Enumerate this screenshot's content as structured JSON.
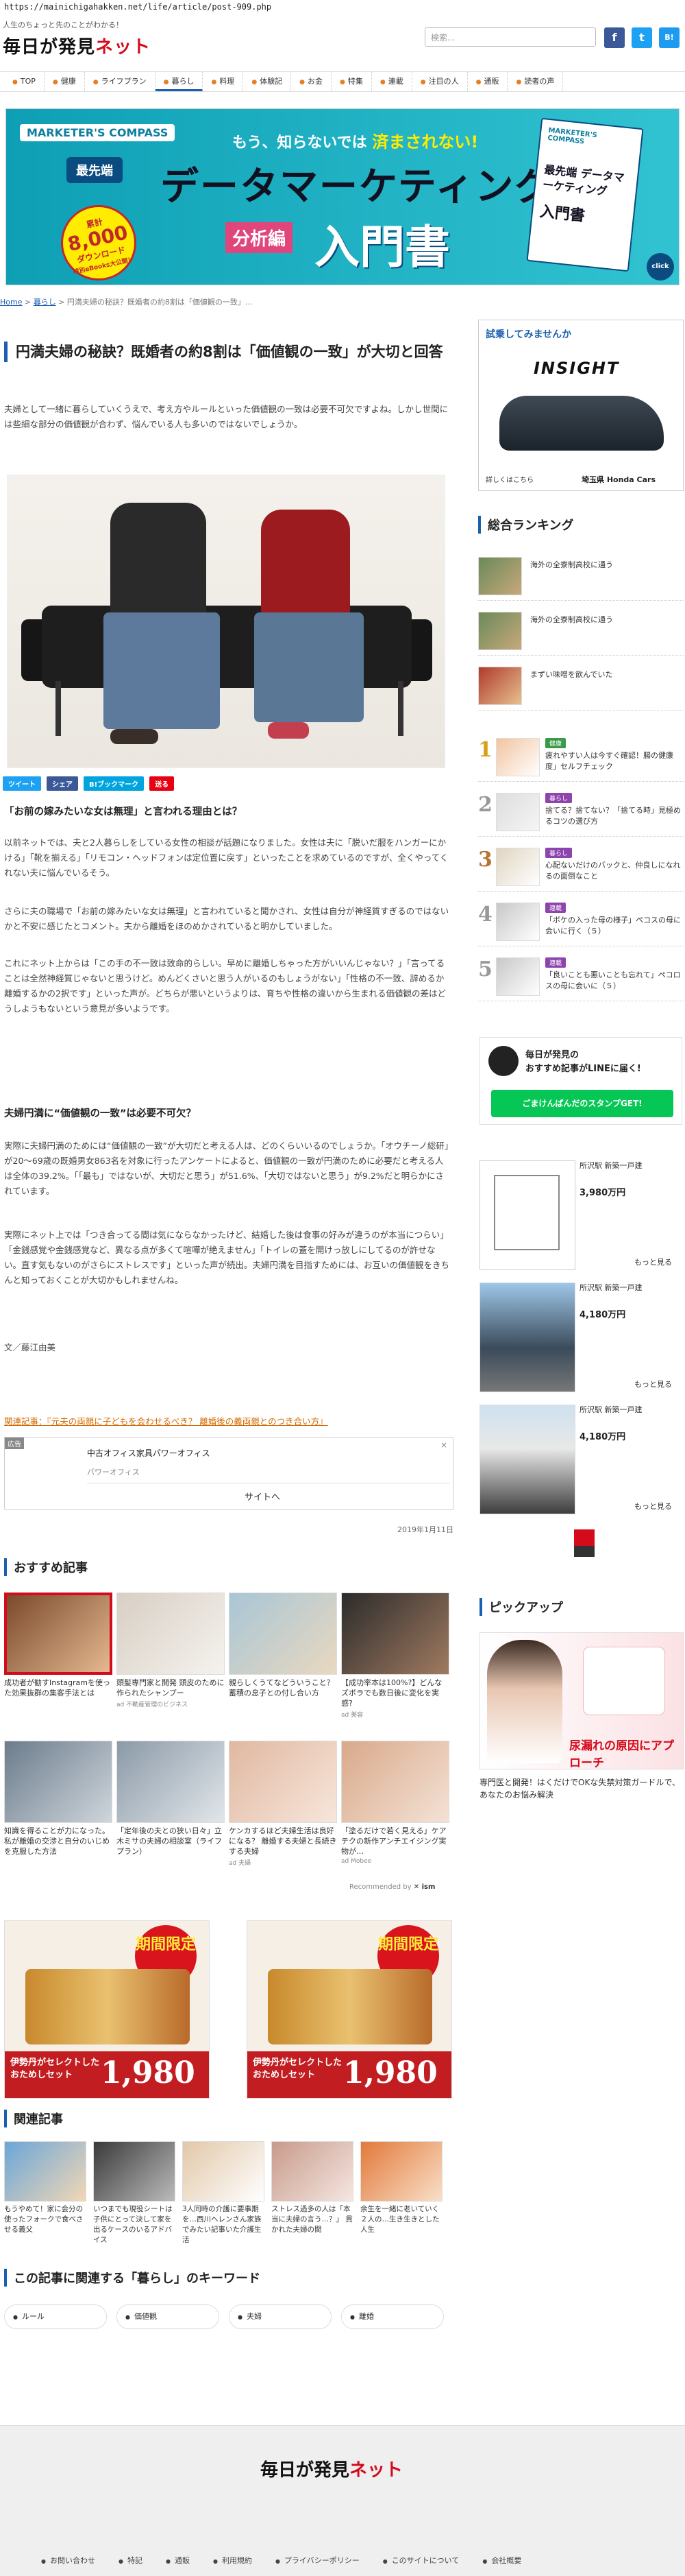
{
  "url": "https://mainichigahakken.net/life/article/post-909.php",
  "header": {
    "tagline": "人生のちょっと先のことがわかる！",
    "logo_main": "毎日が発見",
    "logo_net": "ネット",
    "search_placeholder": "検索...",
    "social": [
      "f",
      "t",
      "B!"
    ]
  },
  "nav": {
    "items": [
      {
        "label": "TOP"
      },
      {
        "label": "健康"
      },
      {
        "label": "ライフプラン"
      },
      {
        "label": "暮らし"
      },
      {
        "label": "料理"
      },
      {
        "label": "体験記"
      },
      {
        "label": "お金"
      },
      {
        "label": "特集"
      },
      {
        "label": "連載"
      },
      {
        "label": "注目の人"
      },
      {
        "label": "通販"
      },
      {
        "label": "読者の声"
      }
    ]
  },
  "banner": {
    "brand": "MARKETER'S COMPASS",
    "tag": "最先端",
    "top": "もう、知らないでは",
    "top_em": "済まされない!",
    "title": "データマーケティング",
    "sub1": "分析編",
    "sub2": "入門書",
    "badge_line1": "累計",
    "badge_big": "8,000",
    "badge_line2": "ダウンロード",
    "badge_line3": "特別eBooks大公開！",
    "book_brand": "MARKETER'S COMPASS",
    "book_title": "最先端 データマーケティング",
    "book_sub": "入門書",
    "click": "click"
  },
  "breadcrumb": {
    "home": "Home",
    "cat": "暮らし",
    "current": "円満夫婦の秘訣？既婚者の約8割は「価値観の一致」..."
  },
  "article": {
    "title": "円満夫婦の秘訣？既婚者の約8割は「価値観の一致」が大切と回答",
    "intro": "夫婦として一緒に暮らしていくうえで、考え方やルールといった価値観の一致は必要不可欠ですよね。しかし世間には些細な部分の価値観が合わず、悩んでいる人も多いのではないでしょうか。",
    "share": [
      "ツイート",
      "シェア",
      "B!ブックマーク",
      "送る"
    ],
    "h_1": "「お前の嫁みたいな女は無理」と言われる理由とは？",
    "p_1": "以前ネットでは、夫と2人暮らしをしている女性の相談が話題になりました。女性は夫に「脱いだ服をハンガーにかける」「靴を揃える」「リモコン・ヘッドフォンは定位置に戻す」といったことを求めているのですが、全くやってくれない夫に悩んでいるそう。",
    "p_2": "さらに夫の職場で「お前の嫁みたいな女は無理」と言われていると聞かされ、女性は自分が神経質すぎるのではないかと不安に感じたとコメント。夫から離婚をほのめかされていると明かしていました。",
    "p_3": "これにネット上からは「この手の不一致は致命的らしい。早めに離婚しちゃった方がいいんじゃない？」「言ってることは全然神経質じゃないと思うけど。めんどくさいと思う人がいるのもしょうがない」「性格の不一致、辞めるか離婚するかの2択です」といった声が。どちらが悪いというよりは、育ちや性格の違いから生まれる価値観の差はどうしようもないという意見が多いようです。",
    "h_2": "夫婦円満に“価値観の一致”は必要不可欠？",
    "p_4": "実際に夫婦円満のためには“価値観の一致”が大切だと考える人は、どのくらいいるのでしょうか。「オウチーノ総研」が20〜69歳の既婚男女863名を対象に行ったアンケートによると、価値観の一致が円満のために必要だと考える人は全体の39.2%。「「最も」ではないが、大切だと思う」が51.6%、「大切ではないと思う」が9.2%だと明らかにされています。",
    "p_5": "実際にネット上では「つき合ってる間は気にならなかったけど、結婚した後は食事の好みが違うのが本当につらい」「金銭感覚や金銭感覚など、異なる点が多くて喧嘩が絶えません」「トイレの蓋を開けっ放しにしてるのが許せない。直す気もないのがさらにストレスです」といった声が続出。夫婦円満を目指すためには、お互いの価値観をきちんと知っておくことが大切かもしれませんね。",
    "author": "文／藤江由美",
    "related_link": "関連記事：『元夫の両親に子どもを会わせるべき？ 離婚後の義両親とのつき合い方』",
    "date": "2019年1月11日"
  },
  "ad": {
    "label": "広告",
    "title": "中古オフィス家具パワーオフィス",
    "sub": "パワーオフィス",
    "cta": "サイトへ",
    "close": "×"
  },
  "recommend": {
    "heading": "おすすめ記事",
    "items": [
      {
        "cap": "成功者が勧すInstagramを使った効果抜群の集客手法とは",
        "src": ""
      },
      {
        "cap": "頭髪専門家と開発 頭皮のために作られたシャンプー",
        "src": "ad 不動産管理のビジネス"
      },
      {
        "cap": "親らしくうてなどういうこと？蓄積の息子との付し合い方",
        "src": ""
      },
      {
        "cap": "【成功率本は100%?】どんなズボラでも数日後に変化を実感?",
        "src": "ad 美容"
      },
      {
        "cap": "知識を得ることが力になった。私が離婚の交渉と自分のいじめを克服した方法",
        "src": ""
      },
      {
        "cap": "「定年後の夫との狭い日々」立木ミサの夫婦の相談室（ライフプラン）",
        "src": ""
      },
      {
        "cap": "ケンカするほど夫婦生活は良好になる？ 離婚する夫婦と長続きする夫婦",
        "src": "ad 夫婦"
      },
      {
        "cap": "「塗るだけで若く見える」ケアテクの新作アンチエイジング実物が…",
        "src": "ad Mobee"
      }
    ],
    "recommended_by": "Recommended by"
  },
  "promos": [
    {
      "tag": "期間限定",
      "text": "伊勢丹がセレクトしたおためしセット",
      "price": "1,980円"
    },
    {
      "tag": "期間限定",
      "text": "伊勢丹がセレクトしたおためしセット",
      "price": "1,980円"
    }
  ],
  "related": {
    "heading": "関連記事",
    "items": [
      {
        "cap": "もうやめて！家に会分の使ったフォークで食べさせる義父"
      },
      {
        "cap": "いつまでも現役シートは子供にとって決して家を出るケースのいるアドバイス"
      },
      {
        "cap": "3人同時の介護に要事期を…西川ヘレンさん家族でみたい記事いた介護生活"
      },
      {
        "cap": "ストレス過多の人は「本当に夫婦の言う…？」 貫かれた夫婦の間"
      },
      {
        "cap": "余生を一緒に老いていく２人の…生き生きとした人生"
      }
    ]
  },
  "keywords": {
    "heading": "この記事に関連する「暮らし」のキーワード",
    "items": [
      "ルール",
      "価値観",
      "夫婦",
      "離婚"
    ]
  },
  "sidebar": {
    "ad_label": "試乗してみませんか",
    "ad_model": "INSIGHT",
    "ad_more": "詳しくはこちら",
    "ad_dealer": "埼玉県 Honda Cars",
    "ranking_heading": "総合ランキング",
    "ranking": [
      {
        "num": "",
        "title": "海外の全寮制高校に通う",
        "cat": ""
      },
      {
        "num": "",
        "title": "海外の全寮制高校に通う",
        "cat": ""
      },
      {
        "num": "",
        "title": "まずい味噌を飲んでいた",
        "cat": ""
      },
      {
        "num": "1",
        "title": "疲れやすい人は今すぐ確認！腸の健康度」セルフチェック",
        "cat": "健康"
      },
      {
        "num": "2",
        "title": "捨てる？捨てない？「捨てる時」見極めるコツの選び方",
        "cat": "暮らし"
      },
      {
        "num": "3",
        "title": "心配ないだけのバックと、仲良しになれるの面倒なこと",
        "cat": "暮らし"
      },
      {
        "num": "4",
        "title": "「ボケの入った母の様子」ペコスの母に会いに行く（５）",
        "cat": "連載"
      },
      {
        "num": "5",
        "title": "「良いことも悪いことも忘れて」ペコロスの母に会いに（５）",
        "cat": "連載"
      }
    ],
    "line_title": "毎日が発見の",
    "line_sub": "おすすめ記事がLINEに届く!",
    "line_btn": "ごまけんぱんだのスタンプGET!",
    "realestate": [
      {
        "title": "所沢駅 新築一戸建",
        "price": "3,980万円",
        "more": "もっと見る"
      },
      {
        "title": "所沢駅 新築一戸建",
        "price": "4,180万円",
        "more": "もっと見る"
      },
      {
        "title": "所沢駅 新築一戸建",
        "price": "4,180万円",
        "more": "もっと見る"
      }
    ],
    "pickup_heading": "ピックアップ",
    "pickup_img_text": "尿漏れの原因にアプローチ",
    "pickup_cap": "専門医と開発！はくだけでOKな失禁対策ガードルで、あなたのお悩み解決"
  },
  "footer": {
    "logo_main": "毎日が発見",
    "logo_net": "ネット",
    "links": [
      "お問い合わせ",
      "特記",
      "通販",
      "利用規約",
      "プライバシーポリシー",
      "このサイトについて",
      "会社概要"
    ]
  },
  "colors": {
    "accent": "#1b5fb1",
    "brand_red": "#d40b1b",
    "line_green": "#06c755"
  }
}
